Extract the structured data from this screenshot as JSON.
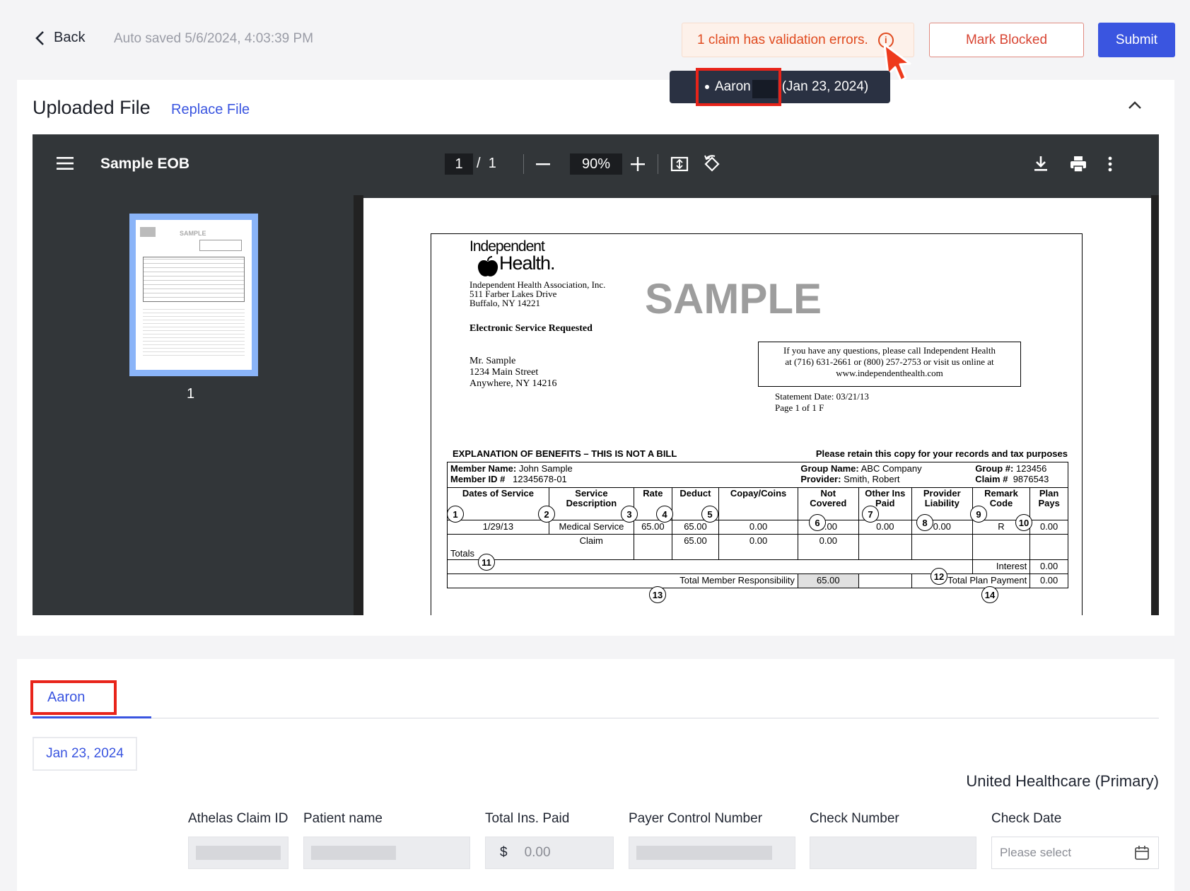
{
  "topbar": {
    "back_label": "Back",
    "autosave": "Auto saved 5/6/2024, 4:03:39 PM",
    "validation_error": "1 claim has validation errors.",
    "mark_blocked_label": "Mark Blocked",
    "submit_label": "Submit"
  },
  "tooltip": {
    "patient": "Aaron",
    "date": "(Jan 23, 2024)"
  },
  "upload": {
    "title": "Uploaded File",
    "replace_label": "Replace File"
  },
  "viewer": {
    "doc_name": "Sample EOB",
    "current_page": "1",
    "page_sep": "/",
    "total_pages": "1",
    "zoom": "90%",
    "thumb_label": "1",
    "thumb_sample": "SAMPLE"
  },
  "eob": {
    "logo_line1": "Independent",
    "logo_line2": "Health.",
    "sample_watermark": "SAMPLE",
    "address": [
      "Independent Health Association, Inc.",
      "511 Farber Lakes Drive",
      "Buffalo, NY 14221"
    ],
    "service_requested": "Electronic Service Requested",
    "recipient": [
      "Mr. Sample",
      "1234 Main Street",
      "Anywhere, NY  14216"
    ],
    "questions": [
      "If you have any questions, please call Independent Health",
      "at (716) 631-2661 or (800) 257-2753 or visit us online at",
      "www.independenthealth.com"
    ],
    "statement_date": "Statement Date: 03/21/13",
    "page_info": "Page 1 of 1 F",
    "heading": "EXPLANATION OF BENEFITS – THIS IS NOT A BILL",
    "retain": "Please retain this copy for your records and tax purposes",
    "member_name_label": "Member Name:",
    "member_name": "John Sample",
    "member_id_label": "Member ID #",
    "member_id": "12345678-01",
    "group_name_label": "Group Name:",
    "group_name": "ABC Company",
    "provider_label": "Provider:",
    "provider": "Smith, Robert",
    "group_no_label": "Group #:",
    "group_no": "123456",
    "claim_no_label": "Claim #",
    "claim_no": "9876543",
    "columns": [
      "Dates of Service",
      "Service Description",
      "Rate",
      "Deduct",
      "Copay/Coins",
      "Not Covered",
      "Other Ins Paid",
      "Provider Liability",
      "Remark Code",
      "Plan Pays"
    ],
    "row": [
      "1/29/13",
      "Medical Service",
      "65.00",
      "65.00",
      "0.00",
      "0.00",
      "0.00",
      "0.00",
      "R",
      "0.00"
    ],
    "claim_label": "Claim",
    "claim_row": [
      "65.00",
      "0.00",
      "0.00"
    ],
    "totals_label": "Totals",
    "interest_label": "Interest",
    "interest_value": "0.00",
    "total_member_label": "Total Member Responsibility",
    "total_member_value": "65.00",
    "total_plan_label": "Total Plan Payment",
    "total_plan_value": "0.00",
    "markers": [
      "1",
      "2",
      "3",
      "4",
      "5",
      "6",
      "7",
      "8",
      "9",
      "10",
      "11",
      "12",
      "13",
      "14"
    ]
  },
  "claim": {
    "tab_name": "Aaron",
    "date_chip": "Jan 23, 2024",
    "payer": "United Healthcare (Primary)",
    "labels": [
      "Athelas Claim ID",
      "Patient name",
      "Total Ins. Paid",
      "Payer Control Number",
      "Check Number",
      "Check Date"
    ],
    "currency": "$",
    "total_ins_paid": "0.00",
    "check_date_placeholder": "Please select"
  }
}
